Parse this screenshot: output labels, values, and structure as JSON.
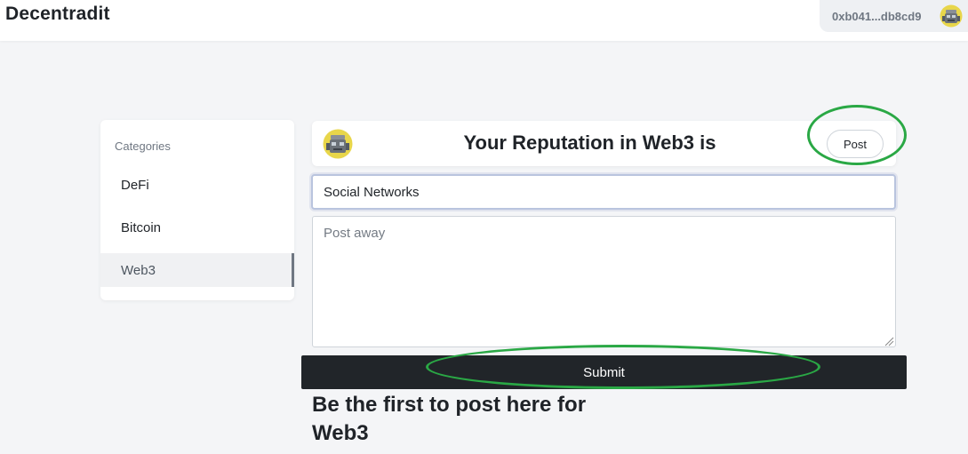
{
  "header": {
    "brand": "Decentradit",
    "wallet_address": "0xb041...db8cd9",
    "avatar_icon": "robot-avatar-icon"
  },
  "sidebar": {
    "title": "Categories",
    "items": [
      {
        "label": "DeFi",
        "active": false
      },
      {
        "label": "Bitcoin",
        "active": false
      },
      {
        "label": "Web3",
        "active": true
      }
    ]
  },
  "reputation": {
    "title": "Your Reputation in Web3 is",
    "post_button": "Post",
    "avatar_icon": "robot-avatar-icon"
  },
  "composer": {
    "title_value": "Social Networks",
    "body_value": "",
    "body_placeholder": "Post away",
    "submit_label": "Submit"
  },
  "feed": {
    "empty_message": "Be the first to post here for Web3"
  },
  "colors": {
    "annotation": "#2aa845",
    "submit_background": "#212529",
    "page_background": "#f4f5f7"
  }
}
